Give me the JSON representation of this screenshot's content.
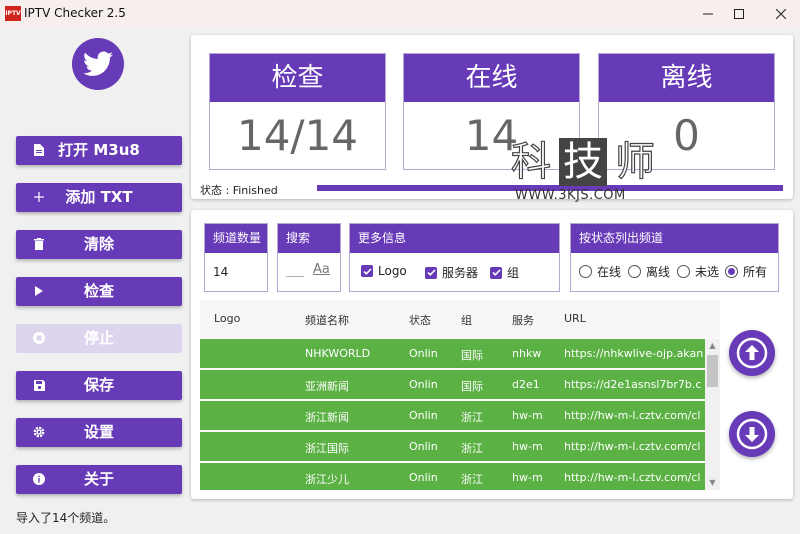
{
  "window": {
    "title": "IPTV Checker 2.5",
    "icon_text": "IPTV",
    "minimize": "minimize-icon",
    "maximize": "maximize-icon",
    "close": "close-icon"
  },
  "sidebar": {
    "avatar_icon": "twitter-bird-icon",
    "buttons": [
      {
        "label": "打开 M3u8",
        "icon": "file-icon",
        "enabled": true
      },
      {
        "label": "添加 TXT",
        "icon": "plus-icon",
        "enabled": true
      },
      {
        "label": "清除",
        "icon": "trash-icon",
        "enabled": true
      },
      {
        "label": "检查",
        "icon": "play-icon",
        "enabled": true
      },
      {
        "label": "停止",
        "icon": "stop-icon",
        "enabled": false
      },
      {
        "label": "保存",
        "icon": "save-icon",
        "enabled": true
      },
      {
        "label": "设置",
        "icon": "gear-icon",
        "enabled": true
      },
      {
        "label": "关于",
        "icon": "info-icon",
        "enabled": true
      }
    ]
  },
  "stats": {
    "check": {
      "label": "检查",
      "value": "14/14"
    },
    "online": {
      "label": "在线",
      "value": "14"
    },
    "offline": {
      "label": "离线",
      "value": "0"
    },
    "status_text": "状态 : Finished",
    "progress": 1.0
  },
  "watermark": {
    "chars": [
      "科",
      "技",
      "师"
    ],
    "url": "WWW.3KJS.COM"
  },
  "filters": {
    "channel_count": {
      "label": "频道数量",
      "value": "14"
    },
    "search": {
      "label": "搜索",
      "placeholder": "___",
      "icon": "font-size-icon",
      "icon_text": "Aa"
    },
    "more_info": {
      "label": "更多信息",
      "options": [
        {
          "label": "Logo",
          "checked": true
        },
        {
          "label": "服务器",
          "checked": true
        },
        {
          "label": "组",
          "checked": true
        }
      ]
    },
    "list_by_status": {
      "label": "按状态列出频道",
      "options": [
        {
          "label": "在线",
          "selected": false
        },
        {
          "label": "离线",
          "selected": false
        },
        {
          "label": "未选",
          "selected": false
        },
        {
          "label": "所有",
          "selected": true
        }
      ]
    }
  },
  "table": {
    "columns": [
      "Logo",
      "频道名称",
      "状态",
      "组",
      "服务",
      "URL"
    ],
    "rows": [
      {
        "logo": "",
        "name": "NHKWORLD",
        "status": "Onlin",
        "group": "国际",
        "server": "nhkw",
        "url": "https://nhkwlive-ojp.akan"
      },
      {
        "logo": "",
        "name": "亚洲新闻",
        "status": "Onlin",
        "group": "国际",
        "server": "d2e1",
        "url": "https://d2e1asnsl7br7b.c"
      },
      {
        "logo": "",
        "name": "浙江新闻",
        "status": "Onlin",
        "group": "浙江",
        "server": "hw-m",
        "url": "http://hw-m-l.cztv.com/cl"
      },
      {
        "logo": "",
        "name": "浙江国际",
        "status": "Onlin",
        "group": "浙江",
        "server": "hw-m",
        "url": "http://hw-m-l.cztv.com/cl"
      },
      {
        "logo": "",
        "name": "浙江少儿",
        "status": "Onlin",
        "group": "浙江",
        "server": "hw-m",
        "url": "http://hw-m-l.cztv.com/cl"
      }
    ],
    "row_color": "#5cb145"
  },
  "actions": {
    "up_icon": "arrow-up-circle-icon",
    "down_icon": "arrow-down-circle-icon"
  },
  "statusbar": {
    "text": "导入了14个频道。"
  },
  "theme": {
    "accent": "#673ab7",
    "accent_disabled": "#ddd4ee",
    "online_green": "#5cb145"
  }
}
